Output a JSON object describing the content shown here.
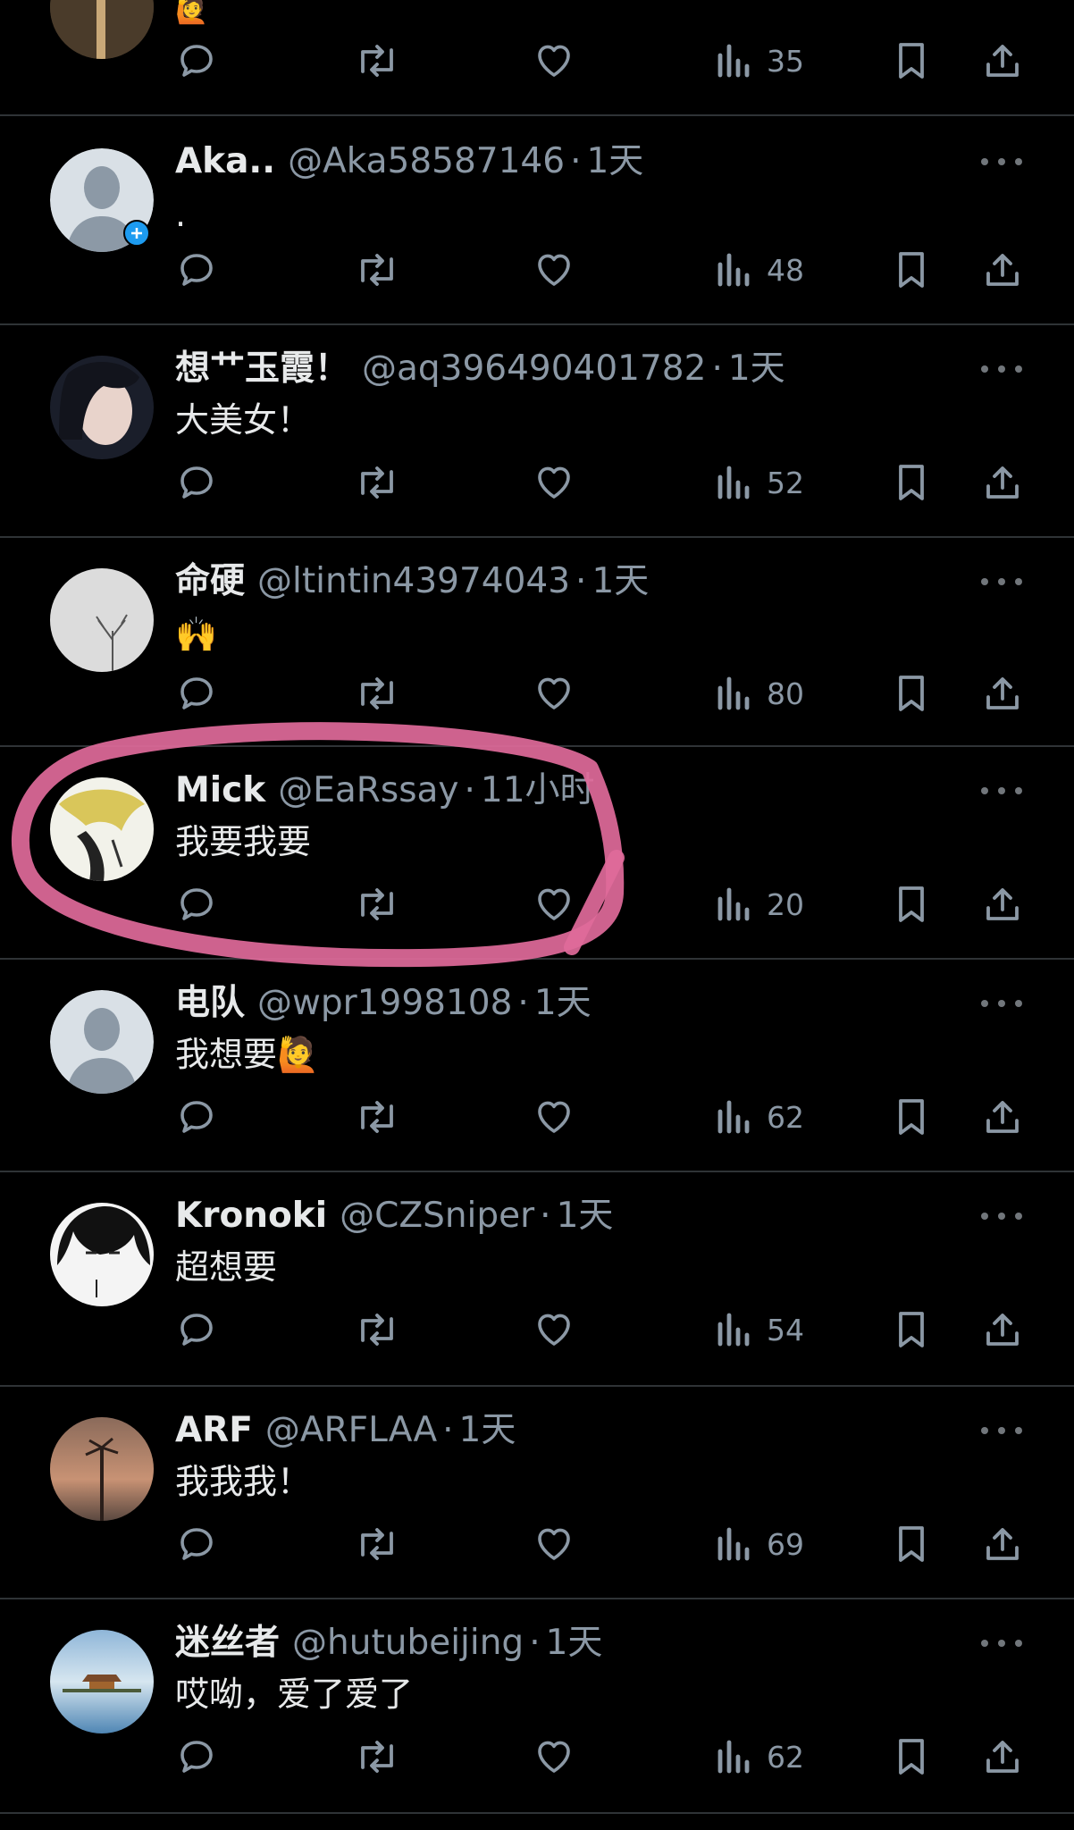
{
  "feed": {
    "first_partial": {
      "views": "35"
    },
    "tweets": [
      {
        "name": "Aka..",
        "handle": "@Aka58587146",
        "sep": "·",
        "time": "1天",
        "text": ".",
        "views": "48",
        "avatar": "default-avatar-with-add-badge"
      },
      {
        "name": "想艹玉霞！",
        "handle": "@aq396490401782",
        "sep": "·",
        "time": "1天",
        "text": "大美女！",
        "views": "52",
        "avatar": "woman-face-avatar"
      },
      {
        "name": "命硬",
        "handle": "@ltintin43974043",
        "sep": "·",
        "time": "1天",
        "text": "🙌",
        "views": "80",
        "avatar": "bare-tree-avatar"
      },
      {
        "name": "Mick",
        "handle": "@EaRssay",
        "sep": "·",
        "time": "11小时",
        "text": "我要我要",
        "views": "20",
        "avatar": "anime-character-avatar"
      },
      {
        "name": "电队",
        "handle": "@wpr1998108",
        "sep": "·",
        "time": "1天",
        "text": "我想要🙋",
        "views": "62",
        "avatar": "default-avatar"
      },
      {
        "name": "Kronoki",
        "handle": "@CZSniper",
        "sep": "·",
        "time": "1天",
        "text": "超想要",
        "views": "54",
        "avatar": "dark-hair-sketch-avatar"
      },
      {
        "name": "ARF",
        "handle": "@ARFLAA",
        "sep": "·",
        "time": "1天",
        "text": "我我我！",
        "views": "69",
        "avatar": "sunset-palm-avatar"
      },
      {
        "name": "迷丝者",
        "handle": "@hutubeijing",
        "sep": "·",
        "time": "1天",
        "text": "哎呦，爱了爱了",
        "views": "62",
        "avatar": "palace-lake-avatar"
      }
    ]
  },
  "icons": {
    "reply": "reply-icon",
    "retweet": "retweet-icon",
    "like": "heart-icon",
    "views": "views-icon",
    "bookmark": "bookmark-icon",
    "share": "share-icon",
    "more": "more-icon"
  },
  "colors": {
    "background": "#000000",
    "text": "#e7e9ea",
    "secondary": "#8b98a5",
    "divider": "#2f3336",
    "annotation": "#e06a9a"
  }
}
